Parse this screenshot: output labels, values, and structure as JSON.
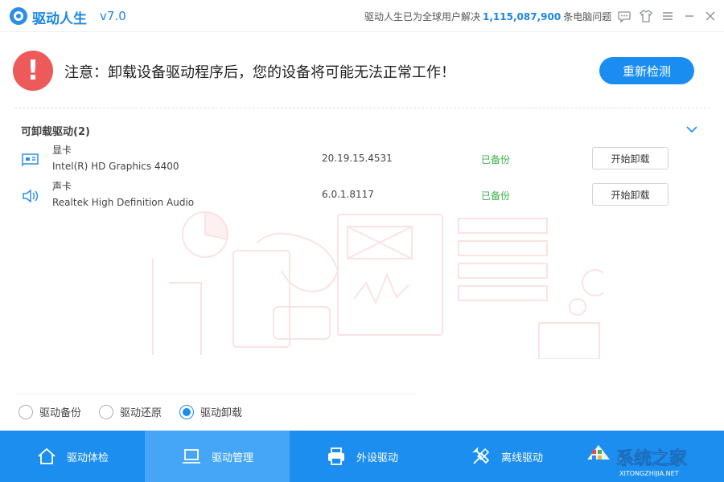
{
  "app": {
    "title": "驱动人生",
    "version": "v7.0",
    "stats_prefix": "驱动人生已为全球用户解决",
    "stats_number": "1,115,087,900",
    "stats_suffix": "条电脑问题"
  },
  "titlebar_icons": [
    "chat-icon",
    "shirt-icon",
    "menu-icon",
    "minimize-icon",
    "close-icon"
  ],
  "warning": {
    "icon": "!",
    "text": "注意：卸载设备驱动程序后，您的设备将可能无法正常工作！",
    "button": "重新检测"
  },
  "section": {
    "title": "可卸载驱动(2)"
  },
  "drivers": [
    {
      "icon": "graphics-card-icon",
      "type": "显卡",
      "name": "Intel(R) HD Graphics 4400",
      "version": "20.19.15.4531",
      "status": "已备份",
      "action": "开始卸载"
    },
    {
      "icon": "speaker-icon",
      "type": "声卡",
      "name": "Realtek High Definition Audio",
      "version": "6.0.1.8117",
      "status": "已备份",
      "action": "开始卸载"
    }
  ],
  "radio_options": [
    {
      "label": "驱动备份",
      "checked": false
    },
    {
      "label": "驱动还原",
      "checked": false
    },
    {
      "label": "驱动卸载",
      "checked": true
    }
  ],
  "bottom_nav": [
    {
      "label": "驱动体检",
      "icon": "home-icon",
      "active": false
    },
    {
      "label": "驱动管理",
      "icon": "laptop-icon",
      "active": true
    },
    {
      "label": "外设驱动",
      "icon": "printer-icon",
      "active": false
    },
    {
      "label": "离线驱动",
      "icon": "tools-icon",
      "active": false
    },
    {
      "label": "",
      "icon": "more-icon",
      "active": false
    }
  ],
  "watermark": {
    "text": "系统之家",
    "subtext": "XITONGZHIJIA.NET"
  },
  "colors": {
    "accent": "#1a8ef0",
    "warning": "#ee5a5a",
    "success": "#3bb34a",
    "nav_active": "#45a6f7"
  }
}
